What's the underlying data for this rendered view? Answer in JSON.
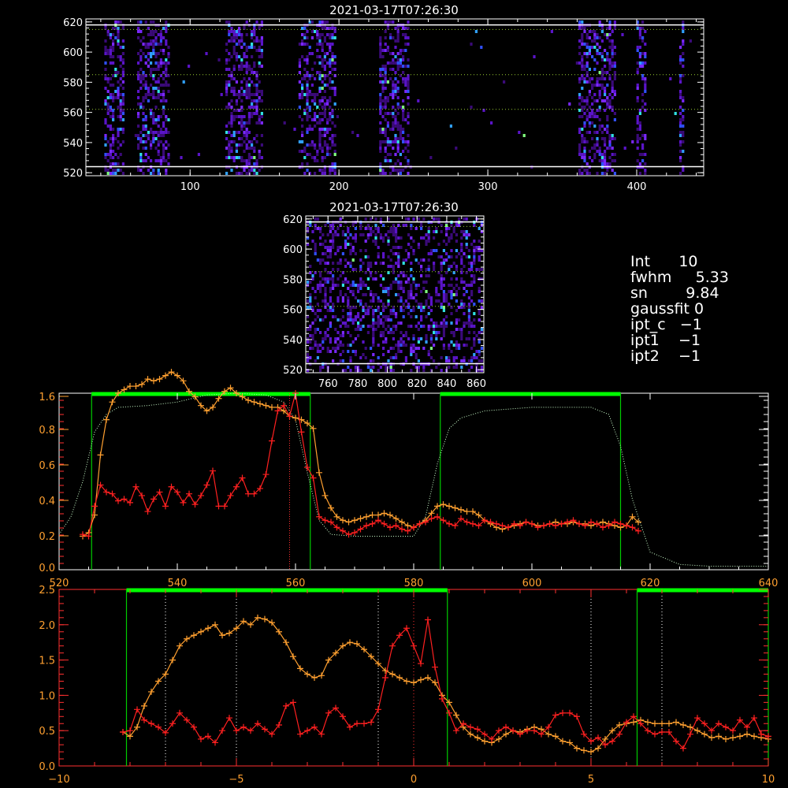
{
  "colors": {
    "background": "#000000",
    "frame": "#ffffff",
    "grid_dots": "#9acd32",
    "red_series": "#ff2020",
    "orange_series": "#ffa030",
    "bright_green": "#00ff00",
    "mid_green": "#00cc00",
    "filter_dotted": "#ccffcc",
    "red_axis": "#ff3030",
    "orange_ticks": "#ffa030",
    "heatmap_palette": [
      "#3a0a78",
      "#5a14c8",
      "#7a28ff",
      "#3050ff",
      "#30a0ff",
      "#30e0e0",
      "#80ff80"
    ]
  },
  "info_panel": {
    "int": "Int      10",
    "fwhm": "fwhm     5.33",
    "sn": "sn        9.84",
    "gaussfit": "gaussfit 0",
    "ipt_c": "ipt_c   −1",
    "ipt1": "ipt1    −1",
    "ipt2": "ipt2    −1"
  },
  "chart_data": [
    {
      "type": "heatmap",
      "title": "2021-03-17T07:26:30",
      "xlim": [
        30,
        445
      ],
      "ylim": [
        518,
        622
      ],
      "xticks": [
        "100",
        "200",
        "300",
        "400"
      ],
      "yticks": [
        "520",
        "540",
        "560",
        "580",
        "600",
        "620"
      ],
      "signal_bands_x": [
        [
          42,
          55
        ],
        [
          63,
          85
        ],
        [
          122,
          148
        ],
        [
          172,
          197
        ],
        [
          226,
          246
        ],
        [
          360,
          385
        ],
        [
          399,
          406
        ],
        [
          427,
          431
        ]
      ],
      "reference_lines_y": {
        "solid": [
          524,
          618
        ],
        "dotted": [
          562,
          585,
          615
        ]
      }
    },
    {
      "type": "heatmap",
      "title": "2021-03-17T07:26:30",
      "xlim": [
        745,
        865
      ],
      "ylim": [
        518,
        622
      ],
      "xticks": [
        "760",
        "780",
        "800",
        "820",
        "840",
        "860"
      ],
      "yticks": [
        "520",
        "540",
        "560",
        "580",
        "600",
        "620"
      ],
      "reference_lines_y": {
        "solid": [
          524,
          618
        ],
        "dotted": [
          562,
          585,
          615
        ]
      }
    },
    {
      "type": "line",
      "xlim": [
        520,
        640
      ],
      "ylim": [
        0,
        1.0
      ],
      "xticks": [
        "520",
        "540",
        "560",
        "580",
        "600",
        "620",
        "640"
      ],
      "yticks_overlap": [
        "1.6",
        "0.8",
        "0.6",
        "0.4",
        "0.2",
        "0.0"
      ],
      "green_windows": [
        [
          525.5,
          562.5
        ],
        [
          584.5,
          615
        ]
      ],
      "vertical_marker": 559,
      "filter_curve": {
        "x": [
          520,
          522,
          524,
          526,
          528,
          530,
          535,
          540,
          545,
          550,
          555,
          558,
          560,
          562,
          564,
          566,
          570,
          575,
          580,
          582,
          584,
          586,
          588,
          592,
          600,
          605,
          610,
          613,
          615,
          617,
          620,
          625,
          630,
          635,
          640
        ],
        "y": [
          0.2,
          0.3,
          0.5,
          0.78,
          0.88,
          0.92,
          0.93,
          0.95,
          0.99,
          1.0,
          0.99,
          0.95,
          0.85,
          0.55,
          0.28,
          0.2,
          0.19,
          0.19,
          0.19,
          0.3,
          0.6,
          0.8,
          0.86,
          0.9,
          0.92,
          0.92,
          0.92,
          0.88,
          0.7,
          0.4,
          0.1,
          0.03,
          0.02,
          0.02,
          0.02
        ]
      },
      "series": [
        {
          "x": [
            524,
            525,
            526,
            527,
            528,
            529,
            530,
            531,
            532,
            533,
            534,
            535,
            536,
            537,
            538,
            539,
            540,
            541,
            542,
            543,
            544,
            545,
            546,
            547,
            548,
            549,
            550,
            551,
            552,
            553,
            554,
            555,
            556,
            557,
            558,
            559,
            560,
            561,
            562,
            563,
            564,
            565,
            566,
            567,
            568,
            569,
            570,
            571,
            572,
            573,
            574,
            575,
            576,
            577,
            578,
            579,
            580,
            581,
            582,
            583,
            584,
            585,
            586,
            587,
            588,
            589,
            590,
            591,
            592,
            593,
            594,
            595,
            596,
            597,
            598,
            599,
            600,
            601,
            602,
            603,
            604,
            605,
            606,
            607,
            608,
            609,
            610,
            611,
            612,
            613,
            614,
            615,
            616,
            617,
            618
          ],
          "values": [
            0.19,
            0.21,
            0.31,
            0.65,
            0.85,
            0.95,
            1.0,
            1.02,
            1.04,
            1.04,
            1.05,
            1.08,
            1.07,
            1.08,
            1.1,
            1.12,
            1.1,
            1.07,
            1.01,
            0.98,
            0.93,
            0.9,
            0.92,
            0.97,
            1.01,
            1.03,
            1.0,
            0.98,
            0.96,
            0.95,
            0.94,
            0.93,
            0.92,
            0.92,
            0.9,
            0.87,
            0.86,
            0.85,
            0.83,
            0.8,
            0.55,
            0.42,
            0.35,
            0.3,
            0.28,
            0.27,
            0.28,
            0.29,
            0.3,
            0.31,
            0.31,
            0.32,
            0.31,
            0.29,
            0.27,
            0.25,
            0.24,
            0.26,
            0.28,
            0.32,
            0.36,
            0.37,
            0.36,
            0.35,
            0.34,
            0.33,
            0.33,
            0.31,
            0.28,
            0.26,
            0.24,
            0.23,
            0.24,
            0.25,
            0.26,
            0.27,
            0.26,
            0.25,
            0.25,
            0.26,
            0.27,
            0.26,
            0.26,
            0.27,
            0.26,
            0.26,
            0.25,
            0.26,
            0.27,
            0.26,
            0.25,
            0.24,
            0.25,
            0.3,
            0.27
          ]
        },
        {
          "x": [
            524,
            525,
            526,
            527,
            528,
            529,
            530,
            531,
            532,
            533,
            534,
            535,
            536,
            537,
            538,
            539,
            540,
            541,
            542,
            543,
            544,
            545,
            546,
            547,
            548,
            549,
            550,
            551,
            552,
            553,
            554,
            555,
            556,
            557,
            558,
            559,
            560,
            561,
            562,
            563,
            564,
            565,
            566,
            567,
            568,
            569,
            570,
            571,
            572,
            573,
            574,
            575,
            576,
            577,
            578,
            579,
            580,
            581,
            582,
            583,
            584,
            585,
            586,
            587,
            588,
            589,
            590,
            591,
            592,
            593,
            594,
            595,
            596,
            597,
            598,
            599,
            600,
            601,
            602,
            603,
            604,
            605,
            606,
            607,
            608,
            609,
            610,
            611,
            612,
            613,
            614,
            615,
            616,
            617,
            618
          ],
          "values": [
            0.2,
            0.19,
            0.36,
            0.48,
            0.44,
            0.43,
            0.39,
            0.4,
            0.38,
            0.47,
            0.42,
            0.33,
            0.4,
            0.44,
            0.36,
            0.47,
            0.44,
            0.38,
            0.43,
            0.37,
            0.42,
            0.48,
            0.56,
            0.36,
            0.36,
            0.42,
            0.47,
            0.52,
            0.43,
            0.43,
            0.46,
            0.54,
            0.73,
            0.9,
            0.93,
            0.87,
            1.0,
            0.78,
            0.58,
            0.52,
            0.3,
            0.28,
            0.27,
            0.24,
            0.22,
            0.2,
            0.21,
            0.23,
            0.25,
            0.26,
            0.28,
            0.26,
            0.24,
            0.25,
            0.23,
            0.22,
            0.24,
            0.26,
            0.27,
            0.29,
            0.3,
            0.28,
            0.26,
            0.25,
            0.29,
            0.27,
            0.26,
            0.25,
            0.28,
            0.27,
            0.26,
            0.25,
            0.24,
            0.26,
            0.25,
            0.27,
            0.26,
            0.24,
            0.25,
            0.26,
            0.25,
            0.26,
            0.27,
            0.28,
            0.26,
            0.25,
            0.27,
            0.26,
            0.24,
            0.25,
            0.27,
            0.26,
            0.25,
            0.24,
            0.22
          ]
        }
      ]
    },
    {
      "type": "line",
      "xlim": [
        -10,
        10
      ],
      "ylim": [
        0,
        2.5
      ],
      "xticks": [
        "−10",
        "−5",
        "0",
        "5",
        "10"
      ],
      "yticks": [
        "0.0",
        "0.5",
        "1.0",
        "1.5",
        "2.0",
        "2.5"
      ],
      "green_windows": [
        [
          -8.1,
          0.95
        ],
        [
          6.3,
          10
        ]
      ],
      "dotted_verticals": [
        -7,
        -5,
        -1,
        0,
        5,
        7
      ],
      "series": [
        {
          "x": [
            -8.2,
            -8.0,
            -7.8,
            -7.6,
            -7.4,
            -7.2,
            -7.0,
            -6.8,
            -6.6,
            -6.4,
            -6.2,
            -6.0,
            -5.8,
            -5.6,
            -5.4,
            -5.2,
            -5.0,
            -4.8,
            -4.6,
            -4.4,
            -4.2,
            -4.0,
            -3.8,
            -3.6,
            -3.4,
            -3.2,
            -3.0,
            -2.8,
            -2.6,
            -2.4,
            -2.2,
            -2.0,
            -1.8,
            -1.6,
            -1.4,
            -1.2,
            -1.0,
            -0.8,
            -0.6,
            -0.4,
            -0.2,
            0.0,
            0.2,
            0.4,
            0.6,
            0.8,
            1.0,
            1.2,
            1.4,
            1.6,
            1.8,
            2.0,
            2.2,
            2.4,
            2.6,
            2.8,
            3.0,
            3.2,
            3.4,
            3.6,
            3.8,
            4.0,
            4.2,
            4.4,
            4.6,
            4.8,
            5.0,
            5.2,
            5.4,
            5.6,
            5.8,
            6.0,
            6.2,
            6.4,
            6.6,
            6.8,
            7.0,
            7.2,
            7.4,
            7.6,
            7.8,
            8.0,
            8.2,
            8.4,
            8.6,
            8.8,
            9.0,
            9.2,
            9.4,
            9.6,
            9.8,
            10.0
          ],
          "values": [
            0.48,
            0.42,
            0.55,
            0.85,
            1.05,
            1.2,
            1.3,
            1.5,
            1.7,
            1.8,
            1.85,
            1.9,
            1.95,
            2.0,
            1.85,
            1.88,
            1.95,
            2.05,
            2.0,
            2.1,
            2.08,
            2.03,
            1.9,
            1.75,
            1.55,
            1.38,
            1.3,
            1.25,
            1.28,
            1.5,
            1.6,
            1.7,
            1.75,
            1.73,
            1.65,
            1.55,
            1.45,
            1.35,
            1.3,
            1.25,
            1.2,
            1.18,
            1.22,
            1.25,
            1.18,
            1.0,
            0.9,
            0.72,
            0.55,
            0.45,
            0.4,
            0.35,
            0.33,
            0.38,
            0.45,
            0.5,
            0.48,
            0.52,
            0.55,
            0.52,
            0.45,
            0.42,
            0.35,
            0.33,
            0.25,
            0.22,
            0.2,
            0.25,
            0.38,
            0.5,
            0.58,
            0.6,
            0.62,
            0.65,
            0.62,
            0.6,
            0.6,
            0.6,
            0.62,
            0.58,
            0.55,
            0.5,
            0.45,
            0.4,
            0.42,
            0.38,
            0.4,
            0.42,
            0.45,
            0.42,
            0.4,
            0.38
          ]
        },
        {
          "x": [
            -8.2,
            -8.0,
            -7.8,
            -7.6,
            -7.4,
            -7.2,
            -7.0,
            -6.8,
            -6.6,
            -6.4,
            -6.2,
            -6.0,
            -5.8,
            -5.6,
            -5.4,
            -5.2,
            -5.0,
            -4.8,
            -4.6,
            -4.4,
            -4.2,
            -4.0,
            -3.8,
            -3.6,
            -3.4,
            -3.2,
            -3.0,
            -2.8,
            -2.6,
            -2.4,
            -2.2,
            -2.0,
            -1.8,
            -1.6,
            -1.4,
            -1.2,
            -1.0,
            -0.8,
            -0.6,
            -0.4,
            -0.2,
            0.0,
            0.2,
            0.4,
            0.6,
            0.8,
            1.0,
            1.2,
            1.4,
            1.6,
            1.8,
            2.0,
            2.2,
            2.4,
            2.6,
            2.8,
            3.0,
            3.2,
            3.4,
            3.6,
            3.8,
            4.0,
            4.2,
            4.4,
            4.6,
            4.8,
            5.0,
            5.2,
            5.4,
            5.6,
            5.8,
            6.0,
            6.2,
            6.4,
            6.6,
            6.8,
            7.0,
            7.2,
            7.4,
            7.6,
            7.8,
            8.0,
            8.2,
            8.4,
            8.6,
            8.8,
            9.0,
            9.2,
            9.4,
            9.6,
            9.8,
            10.0
          ],
          "values": [
            0.48,
            0.5,
            0.8,
            0.65,
            0.6,
            0.55,
            0.47,
            0.6,
            0.75,
            0.65,
            0.55,
            0.38,
            0.42,
            0.33,
            0.5,
            0.68,
            0.5,
            0.55,
            0.5,
            0.6,
            0.52,
            0.45,
            0.58,
            0.85,
            0.9,
            0.45,
            0.5,
            0.55,
            0.45,
            0.75,
            0.82,
            0.7,
            0.55,
            0.6,
            0.6,
            0.62,
            0.8,
            1.25,
            1.7,
            1.85,
            1.95,
            1.7,
            1.45,
            2.07,
            1.4,
            0.95,
            0.75,
            0.5,
            0.6,
            0.55,
            0.52,
            0.45,
            0.38,
            0.5,
            0.55,
            0.5,
            0.45,
            0.5,
            0.5,
            0.45,
            0.55,
            0.72,
            0.75,
            0.75,
            0.7,
            0.45,
            0.35,
            0.4,
            0.3,
            0.35,
            0.45,
            0.62,
            0.7,
            0.6,
            0.5,
            0.45,
            0.48,
            0.48,
            0.35,
            0.25,
            0.45,
            0.68,
            0.6,
            0.5,
            0.6,
            0.55,
            0.5,
            0.65,
            0.55,
            0.68,
            0.45,
            0.42
          ]
        }
      ]
    }
  ]
}
